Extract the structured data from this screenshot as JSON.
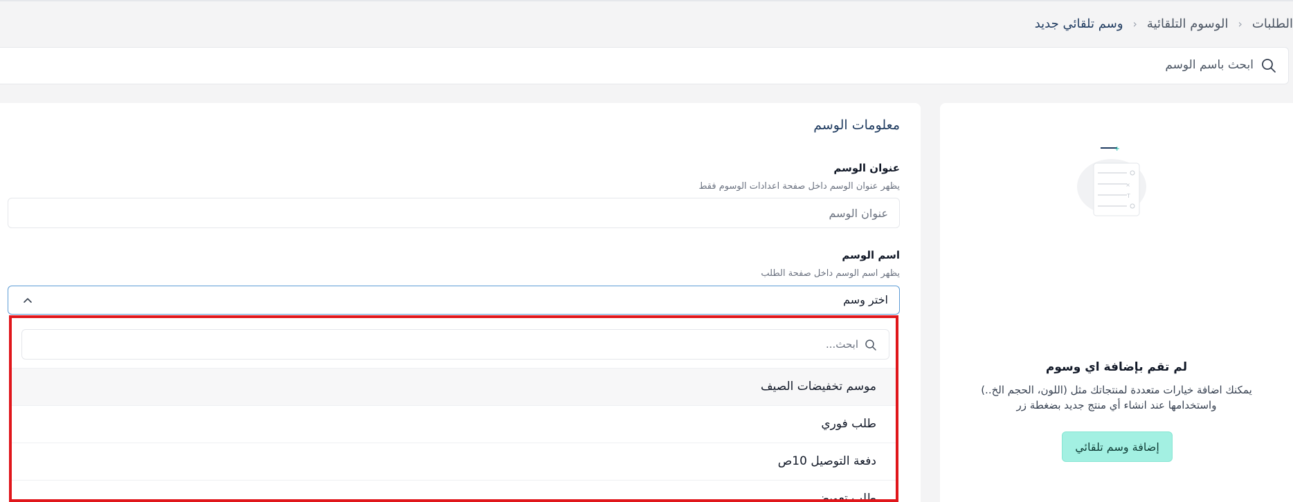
{
  "breadcrumb": {
    "items": [
      "الطلبات",
      "الوسوم التلقائية",
      "وسم تلقائي جديد"
    ]
  },
  "search": {
    "placeholder": "ابحث باسم الوسم"
  },
  "form": {
    "title": "معلومات الوسم",
    "tag_title": {
      "label": "عنوان الوسم",
      "hint": "يظهر عنوان الوسم داخل صفحة اعدادات الوسوم فقط",
      "placeholder": "عنوان الوسم"
    },
    "tag_name": {
      "label": "اسم الوسم",
      "hint": "يظهر اسم الوسم داخل صفحة الطلب",
      "selected": "اختر وسم"
    }
  },
  "dropdown": {
    "search_placeholder": "ابحث...",
    "options": [
      "موسم تخفيضات الصيف",
      "طلب فوري",
      "دفعة التوصيل 10ص",
      "طلب تعويض"
    ]
  },
  "empty_state": {
    "title": "لم تقم بإضافة اي وسوم",
    "description_line1": "يمكنك اضافة خيارات متعددة لمنتجاتك مثل (اللون، الحجم الخ..)",
    "description_line2": "واستخدامها عند انشاء أي منتج جديد بضغطة زر",
    "button_label": "إضافة وسم تلقائي"
  },
  "colors": {
    "accent_button": "#a3f0e2",
    "highlight_border": "#e0161b",
    "select_focus": "#5b9bd5"
  }
}
